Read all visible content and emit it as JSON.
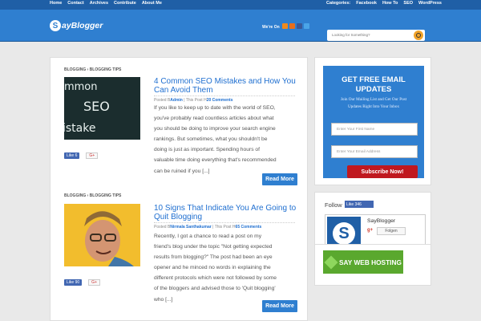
{
  "topbar": {
    "left_links": [
      "Home",
      "Contact",
      "Archives",
      "Contribute",
      "About Me"
    ],
    "right_links": [
      "Categories:",
      "Facebook",
      "How To",
      "SEO",
      "WordPress"
    ]
  },
  "header": {
    "logo_letter": "S",
    "logo_text": "ayBlogger",
    "were_on": "We're On",
    "search_placeholder": "Looking for Something?",
    "social_icons": [
      "rss-icon",
      "blogger-icon",
      "facebook-icon",
      "twitter-icon"
    ],
    "colors": {
      "brand": "#2f7fd0",
      "brand_dark": "#1f5fa6",
      "red": "#c0181f",
      "orange": "#f1a32a",
      "green": "#5aa82e"
    }
  },
  "posts": [
    {
      "category": "BLOGGING › BLOGGING TIPS",
      "thumb_text": "ommon SEO Mistake",
      "title": "4 Common SEO Mistakes and How You Can Avoid Them",
      "meta_prefix": "Posted B",
      "author": "Admin",
      "meta_mid": " | This Post H",
      "comments": "20 Comments",
      "excerpt_lines": [
        "If you like to keep up to date with the world of SEO,",
        "you've probably read countless articles about what",
        "you should be doing to improve your search engine",
        "rankings. But sometimes, what you shouldn't be",
        "doing is just as important. Spending hours of",
        "valuable time doing everything that's recommended",
        "can be ruined if you [...]"
      ],
      "like_label": "Like",
      "like_count": "6",
      "gplus": "G+",
      "read_more": "Read More"
    },
    {
      "category": "BLOGGING › BLOGGING TIPS",
      "title": "10 Signs That Indicate You Are Going to Quit Blogging",
      "meta_prefix": "Posted B",
      "author": "Nirmala Santhakumar",
      "meta_mid": " | This Post H",
      "comments": "65 Comments",
      "excerpt_lines": [
        "Recently, I got a chance to read a post on my",
        "friend's blog under the topic \"Not getting expected",
        "results from blogging?\"  The post had been an eye",
        "opener and he minced no words in explaining the",
        "different protocols which were not followed by some",
        "of the bloggers and advised those to 'Quit blogging'",
        "who [...]"
      ],
      "like_label": "Like",
      "like_count": "90",
      "gplus": "G+",
      "read_more": "Read More"
    }
  ],
  "sidebar": {
    "email": {
      "title_line1": "GET FREE EMAIL",
      "title_line2": "UPDATES",
      "subtitle_line1": "Join Our Mailing List and Get Our Post",
      "subtitle_line2": "Updates Right Into Your Inbox",
      "first_name_placeholder": "Enter Your First Name",
      "email_placeholder": "Enter Your Email Address",
      "button": "Subscribe Now!"
    },
    "follow": {
      "title": "Follow",
      "like_label": "Like",
      "like_count": "346",
      "gp_name": "SayBlogger",
      "gp_g": "g+",
      "gp_button": "Folgen"
    },
    "hosting": {
      "text": "SAY WEB HOSTING"
    }
  }
}
